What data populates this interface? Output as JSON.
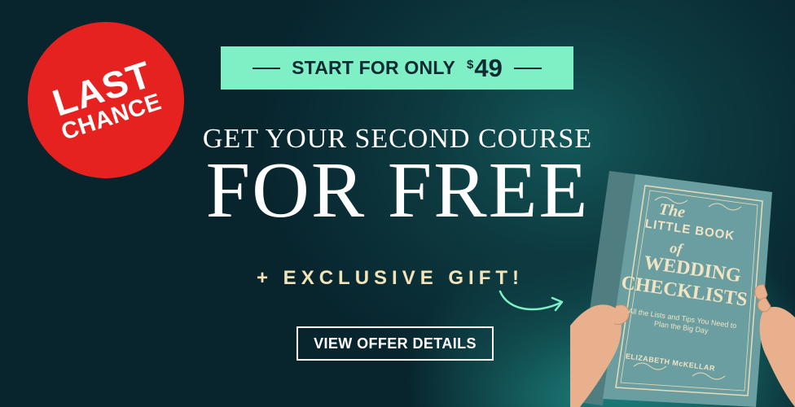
{
  "promo": {
    "badge": {
      "line1": "LAST",
      "line2": "CHANCE"
    },
    "price_pill": {
      "text": "START FOR ONLY",
      "currency": "$",
      "amount": "49"
    },
    "headline_sub": "GET YOUR SECOND COURSE",
    "headline_main": "FOR FREE",
    "gift_text": "+ EXCLUSIVE GIFT!",
    "cta_label": "VIEW OFFER DETAILS",
    "book": {
      "the": "The",
      "little_book": "LITTLE BOOK",
      "of": "of",
      "wedding": "WEDDING",
      "checklists": "CHECKLISTS",
      "tagline": "All the Lists and Tips You Need to Plan the Big Day",
      "author": "ELIZABETH McKELLAR"
    }
  },
  "colors": {
    "background": "#08252e",
    "pill": "#7ff0c6",
    "badge": "#e5221f",
    "gift": "#f3e3b8",
    "arrow": "#7ff0c6"
  }
}
